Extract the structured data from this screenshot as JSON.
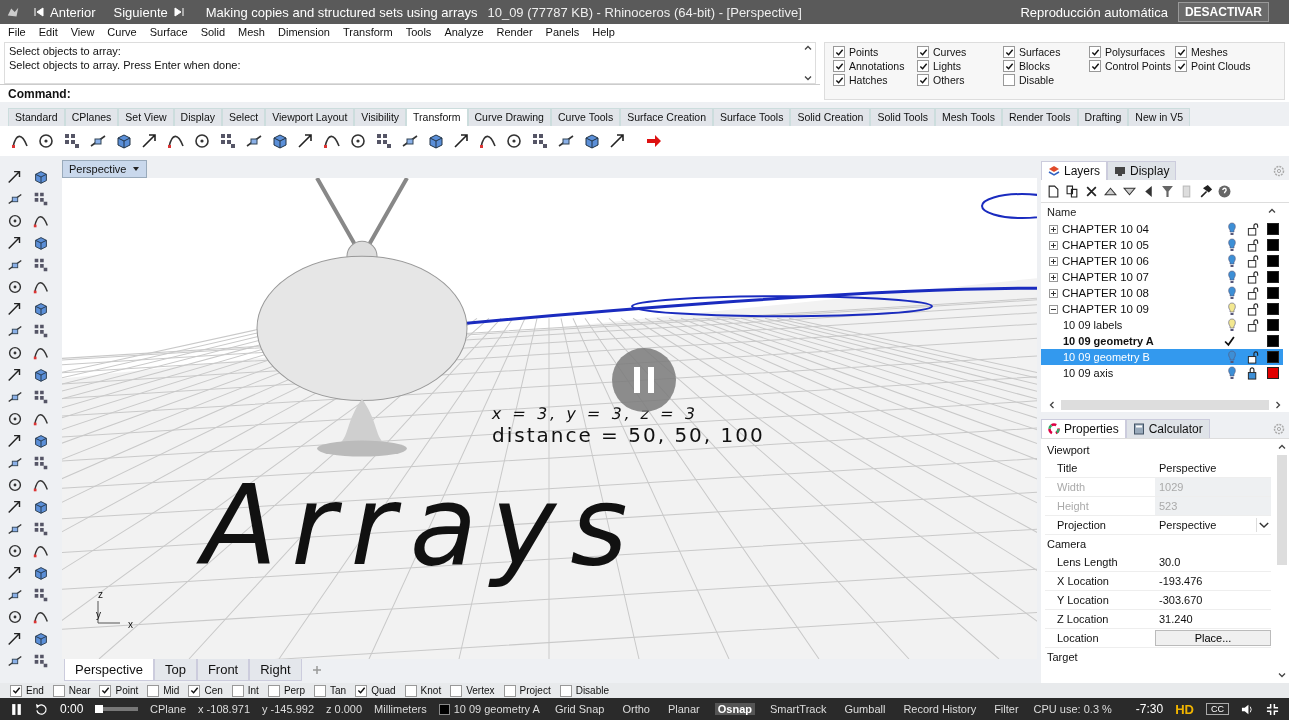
{
  "title_bar": {
    "prev": "Anterior",
    "next": "Siguiente",
    "video_title": "Making copies and structured sets using arrays",
    "window_title": "10_09  (77787 KB) - Rhinoceros (64-bit) - [Perspective]",
    "autoplay_label": "Reproducción automática",
    "autoplay_button": "DESACTIVAR"
  },
  "menu": [
    "File",
    "Edit",
    "View",
    "Curve",
    "Surface",
    "Solid",
    "Mesh",
    "Dimension",
    "Transform",
    "Tools",
    "Analyze",
    "Render",
    "Panels",
    "Help"
  ],
  "command": {
    "history": [
      "Select objects to array:",
      "Select objects to array. Press Enter when done:"
    ],
    "prompt": "Command:"
  },
  "filters": [
    {
      "label": "Points",
      "checked": true
    },
    {
      "label": "Curves",
      "checked": true
    },
    {
      "label": "Surfaces",
      "checked": true
    },
    {
      "label": "Polysurfaces",
      "checked": true
    },
    {
      "label": "Meshes",
      "checked": true
    },
    {
      "label": "Annotations",
      "checked": true
    },
    {
      "label": "Lights",
      "checked": true
    },
    {
      "label": "Blocks",
      "checked": true
    },
    {
      "label": "Control Points",
      "checked": true
    },
    {
      "label": "Point Clouds",
      "checked": true
    },
    {
      "label": "Hatches",
      "checked": true
    },
    {
      "label": "Others",
      "checked": true
    },
    {
      "label": "Disable",
      "checked": false
    }
  ],
  "toolbar_tabs": [
    {
      "label": "Standard",
      "selected": false
    },
    {
      "label": "CPlanes",
      "selected": false
    },
    {
      "label": "Set View",
      "selected": false
    },
    {
      "label": "Display",
      "selected": false
    },
    {
      "label": "Select",
      "selected": false
    },
    {
      "label": "Viewport Layout",
      "selected": false
    },
    {
      "label": "Visibility",
      "selected": false
    },
    {
      "label": "Transform",
      "selected": true
    },
    {
      "label": "Curve Drawing",
      "selected": false
    },
    {
      "label": "Curve Tools",
      "selected": false
    },
    {
      "label": "Surface Creation",
      "selected": false
    },
    {
      "label": "Surface Tools",
      "selected": false
    },
    {
      "label": "Solid Creation",
      "selected": false
    },
    {
      "label": "Solid Tools",
      "selected": false
    },
    {
      "label": "Mesh Tools",
      "selected": false
    },
    {
      "label": "Render Tools",
      "selected": false
    },
    {
      "label": "Drafting",
      "selected": false
    },
    {
      "label": "New in V5",
      "selected": false
    }
  ],
  "viewport": {
    "title": "Perspective",
    "scene_texts": [
      "x = 3, y = 3, z = 3",
      "distance = 50, 50, 100",
      "Arrays"
    ],
    "axes": [
      "z",
      "y",
      "x"
    ],
    "tabs": [
      {
        "label": "Perspective",
        "selected": true
      },
      {
        "label": "Top",
        "selected": false
      },
      {
        "label": "Front",
        "selected": false
      },
      {
        "label": "Right",
        "selected": false
      }
    ]
  },
  "layers": {
    "tabs": [
      {
        "label": "Layers",
        "selected": true
      },
      {
        "label": "Display",
        "selected": false
      }
    ],
    "header": "Name",
    "items": [
      {
        "name": "CHAPTER 10 04",
        "expanded": false,
        "highlighted": false,
        "locked": false,
        "current": false,
        "selected": false,
        "color": "#000000"
      },
      {
        "name": "CHAPTER 10 05",
        "expanded": false,
        "highlighted": false,
        "locked": false,
        "current": false,
        "selected": false,
        "color": "#000000"
      },
      {
        "name": "CHAPTER 10 06",
        "expanded": false,
        "highlighted": false,
        "locked": false,
        "current": false,
        "selected": false,
        "color": "#000000"
      },
      {
        "name": "CHAPTER 10 07",
        "expanded": false,
        "highlighted": false,
        "locked": false,
        "current": false,
        "selected": false,
        "color": "#000000"
      },
      {
        "name": "CHAPTER 10 08",
        "expanded": false,
        "highlighted": false,
        "locked": false,
        "current": false,
        "selected": false,
        "color": "#000000"
      },
      {
        "name": "CHAPTER 10 09",
        "expanded": true,
        "highlighted": true,
        "locked": false,
        "current": false,
        "selected": false,
        "color": "#000000",
        "children": [
          {
            "name": "10 09 labels",
            "highlighted": true,
            "locked": false,
            "current": false,
            "selected": false,
            "color": "#000000"
          },
          {
            "name": "10 09 geometry A",
            "current": true,
            "selected": false,
            "color": "#000000"
          },
          {
            "name": "10 09 geometry B",
            "highlighted": false,
            "locked": false,
            "current": false,
            "selected": true,
            "color": "#000000"
          },
          {
            "name": "10 09 axis",
            "highlighted": false,
            "locked": true,
            "current": false,
            "selected": false,
            "color": "#e00000"
          }
        ]
      }
    ]
  },
  "properties": {
    "tabs": [
      {
        "label": "Properties",
        "selected": true
      },
      {
        "label": "Calculator",
        "selected": false
      }
    ],
    "sections": [
      {
        "title": "Viewport",
        "rows": [
          {
            "label": "Title",
            "value": "Perspective",
            "kind": "text",
            "disabled": false
          },
          {
            "label": "Width",
            "value": "1029",
            "kind": "text",
            "disabled": true
          },
          {
            "label": "Height",
            "value": "523",
            "kind": "text",
            "disabled": true
          },
          {
            "label": "Projection",
            "value": "Perspective",
            "kind": "dropdown",
            "disabled": false
          }
        ]
      },
      {
        "title": "Camera",
        "rows": [
          {
            "label": "Lens Length",
            "value": "30.0",
            "kind": "text",
            "disabled": false
          },
          {
            "label": "X Location",
            "value": "-193.476",
            "kind": "text",
            "disabled": false
          },
          {
            "label": "Y Location",
            "value": "-303.670",
            "kind": "text",
            "disabled": false
          },
          {
            "label": "Z Location",
            "value": "31.240",
            "kind": "text",
            "disabled": false
          },
          {
            "label": "Location",
            "value": "Place...",
            "kind": "button",
            "disabled": false
          }
        ]
      },
      {
        "title": "Target"
      }
    ]
  },
  "osnaps": [
    {
      "label": "End",
      "checked": true
    },
    {
      "label": "Near",
      "checked": false
    },
    {
      "label": "Point",
      "checked": true
    },
    {
      "label": "Mid",
      "checked": false
    },
    {
      "label": "Cen",
      "checked": true
    },
    {
      "label": "Int",
      "checked": false
    },
    {
      "label": "Perp",
      "checked": false
    },
    {
      "label": "Tan",
      "checked": false
    },
    {
      "label": "Quad",
      "checked": true
    },
    {
      "label": "Knot",
      "checked": false
    },
    {
      "label": "Vertex",
      "checked": false
    },
    {
      "label": "Project",
      "checked": false
    },
    {
      "label": "Disable",
      "checked": false
    }
  ],
  "status_bar": [
    {
      "label": "CPlane",
      "kind": "text"
    },
    {
      "label": "x -108.971",
      "kind": "text"
    },
    {
      "label": "y -145.992",
      "kind": "text"
    },
    {
      "label": "z 0.000",
      "kind": "text"
    },
    {
      "label": "Millimeters",
      "kind": "text"
    },
    {
      "label": "10 09 geometry A",
      "kind": "layer",
      "color": "#000000"
    },
    {
      "label": "Grid Snap",
      "kind": "toggle",
      "active": false
    },
    {
      "label": "Ortho",
      "kind": "toggle",
      "active": false
    },
    {
      "label": "Planar",
      "kind": "toggle",
      "active": false
    },
    {
      "label": "Osnap",
      "kind": "toggle",
      "active": true
    },
    {
      "label": "SmartTrack",
      "kind": "toggle",
      "active": false
    },
    {
      "label": "Gumball",
      "kind": "toggle",
      "active": false
    },
    {
      "label": "Record History",
      "kind": "toggle",
      "active": false
    },
    {
      "label": "Filter",
      "kind": "toggle",
      "active": false
    },
    {
      "label": "CPU use: 0.3 %",
      "kind": "text"
    }
  ],
  "video": {
    "elapsed": "0:00",
    "level": 0,
    "remaining": "-7:30",
    "quality": "HD",
    "captions": "CC"
  }
}
